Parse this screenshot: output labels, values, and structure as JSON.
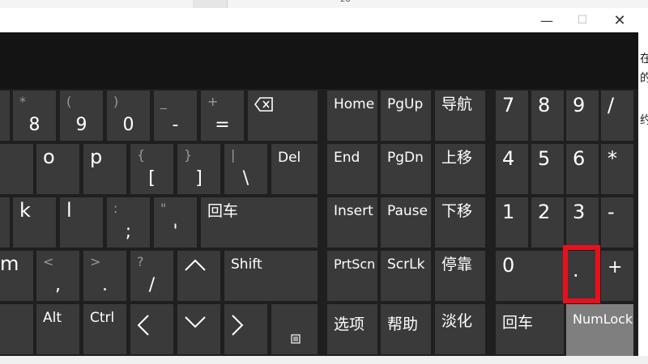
{
  "background_doc": {
    "page_number": "28",
    "right_chars": [
      "在",
      "的",
      "约"
    ]
  },
  "window": {
    "minimize": "—",
    "maximize": "☐",
    "close": "✕"
  },
  "keys": {
    "k8": {
      "shift": "*",
      "main": "8"
    },
    "k9": {
      "shift": "(",
      "main": "9"
    },
    "k0": {
      "shift": ")",
      "main": "0"
    },
    "kminus": {
      "shift": "_",
      "main": "-"
    },
    "kequal": {
      "shift": "+",
      "main": "="
    },
    "ko": "o",
    "kp": "p",
    "kbracketl": {
      "shift": "{",
      "main": "["
    },
    "kbracketr": {
      "shift": "}",
      "main": "]"
    },
    "kbackslash": {
      "shift": "|",
      "main": "\\"
    },
    "del": "Del",
    "kk": "k",
    "kl": "l",
    "ksemicolon": {
      "shift": ":",
      "main": ";"
    },
    "kquote": {
      "shift": "\"",
      "main": "'"
    },
    "enter": "回车",
    "km": "m",
    "kcomma": {
      "shift": "<",
      "main": ","
    },
    "kperiod": {
      "shift": ">",
      "main": "."
    },
    "kslash": {
      "shift": "?",
      "main": "/"
    },
    "shift": "Shift",
    "alt": "Alt",
    "ctrl": "Ctrl",
    "home": "Home",
    "pgup": "PgUp",
    "nav": "导航",
    "end": "End",
    "pgdn": "PgDn",
    "moveup": "上移",
    "insert": "Insert",
    "pause": "Pause",
    "movedown": "下移",
    "prtscn": "PrtScn",
    "scrlk": "ScrLk",
    "dock": "停靠",
    "options": "选项",
    "help": "帮助",
    "fade": "淡化",
    "num7": "7",
    "num8": "8",
    "num9": "9",
    "numslash": "/",
    "num4": "4",
    "num5": "5",
    "num6": "6",
    "numstar": "*",
    "num1": "1",
    "num2": "2",
    "num3": "3",
    "numminus": "-",
    "num0": "0",
    "numdot": ".",
    "numplus": "+",
    "numenter": "回车",
    "numlock": "NumLock"
  },
  "colors": {
    "key_bg": "#3a3a3a",
    "window_bg": "#1f1f1f",
    "numlock_bg": "#7f7f7f",
    "highlight": "#e8101c"
  }
}
